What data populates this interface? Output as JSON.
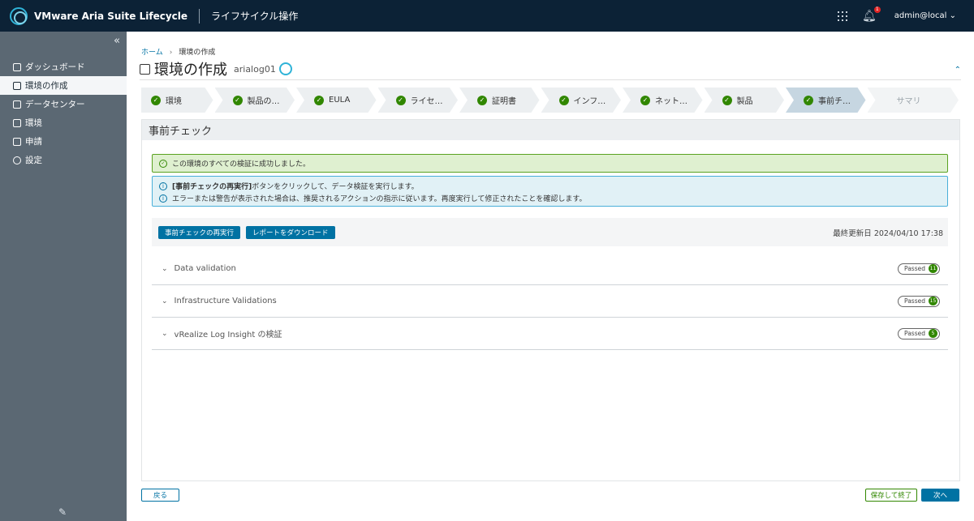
{
  "header": {
    "app_title": "VMware Aria Suite Lifecycle",
    "section": "ライフサイクル操作",
    "notification_count": "1",
    "user": "admin@local"
  },
  "sidebar": {
    "items": [
      {
        "label": "ダッシュボード",
        "icon": "home-icon"
      },
      {
        "label": "環境の作成",
        "icon": "create-environment-icon"
      },
      {
        "label": "データセンター",
        "icon": "datacenter-icon"
      },
      {
        "label": "環境",
        "icon": "environment-icon"
      },
      {
        "label": "申請",
        "icon": "request-icon"
      },
      {
        "label": "設定",
        "icon": "gear-icon"
      }
    ]
  },
  "breadcrumb": {
    "home": "ホーム",
    "current": "環境の作成"
  },
  "page": {
    "title": "環境の作成",
    "env_name": "arialog01"
  },
  "stepper": {
    "steps": [
      "環境",
      "製品の…",
      "EULA",
      "ライセ…",
      "証明書",
      "インフ…",
      "ネット…",
      "製品",
      "事前チ…",
      "サマリ"
    ]
  },
  "panel": {
    "title": "事前チェック",
    "success_message": "この環境のすべての検証に成功しました。",
    "info_line1_bold": "[事前チェックの再実行]",
    "info_line1_rest": " ボタンをクリックして、データ検証を実行します。",
    "info_line2": "エラーまたは警告が表示された場合は、推奨されるアクションの指示に従います。再度実行して修正されたことを確認します。",
    "rerun_button": "事前チェックの再実行",
    "download_button": "レポートをダウンロード",
    "last_updated_label": "最終更新日",
    "last_updated_value": "2024/04/10 17:38",
    "validations": [
      {
        "name": "Data validation",
        "status": "Passed",
        "count": "11"
      },
      {
        "name": "Infrastructure Validations",
        "status": "Passed",
        "count": "15"
      },
      {
        "name": "vRealize Log Insight の検証",
        "status": "Passed",
        "count": "5"
      }
    ]
  },
  "footer": {
    "back": "戻る",
    "save_exit": "保存して終了",
    "next": "次へ"
  },
  "colors": {
    "header_bg": "#0c2236",
    "sidebar_bg": "#5b6873",
    "primary": "#0072a3",
    "success": "#318700"
  }
}
